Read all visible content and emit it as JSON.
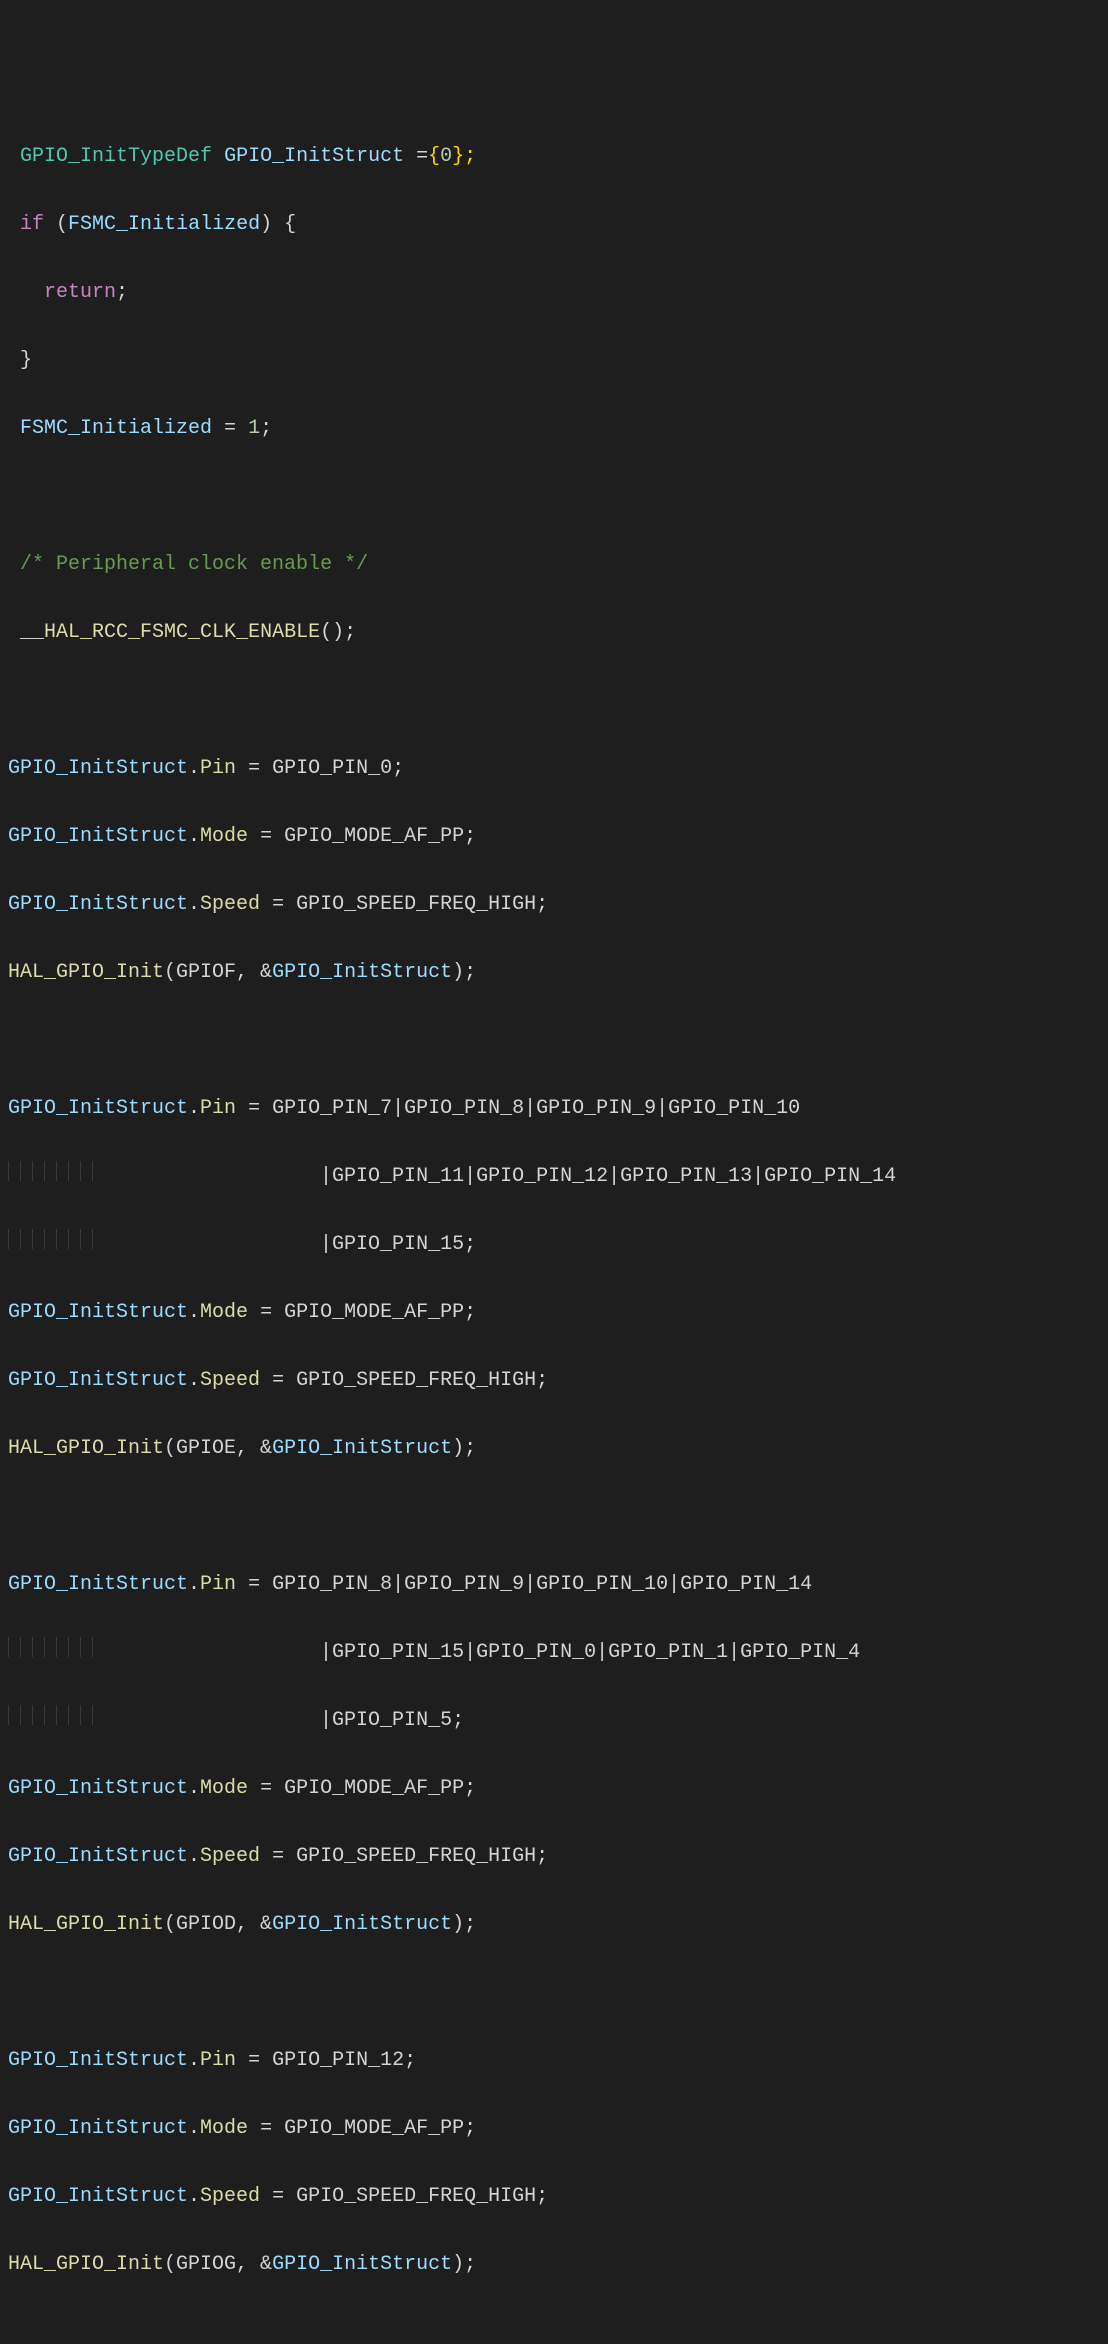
{
  "code": {
    "l1_type": "GPIO_InitTypeDef",
    "l1_var": "GPIO_InitStruct",
    "l1_eq": " =",
    "l1_brace_open": "{",
    "l1_zero": "0",
    "l1_brace_close": "};",
    "l2_if": "if",
    "l2_open": " (",
    "l2_cond": "FSMC_Initialized",
    "l2_close": ") {",
    "l3_return": "return",
    "l3_semi": ";",
    "l4_close": "}",
    "l5_var": "FSMC_Initialized",
    "l5_rest": " = ",
    "l5_one": "1",
    "l5_semi": ";",
    "l7_comment": "/* Peripheral clock enable */",
    "l8_us": "__",
    "l8_macro": "HAL_RCC_FSMC_CLK_ENABLE",
    "l8_call": "();",
    "b1_l1_lhs": "GPIO_InitStruct",
    "b1_l1_dot": ".",
    "b1_l1_mem": "Pin",
    "b1_l1_eq": " = ",
    "b1_l1_rhs": "GPIO_PIN_0;",
    "b1_l2_lhs": "GPIO_InitStruct",
    "b1_l2_mem": "Mode",
    "b1_l2_rhs": "GPIO_MODE_AF_PP;",
    "b1_l3_lhs": "GPIO_InitStruct",
    "b1_l3_mem": "Speed",
    "b1_l3_rhs": "GPIO_SPEED_FREQ_HIGH;",
    "b1_l4_fn": "HAL_GPIO_Init",
    "b1_l4_args1": "(GPIOF, &",
    "b1_l4_args2": "GPIO_InitStruct",
    "b1_l4_args3": ");",
    "b2_l1_lhs": "GPIO_InitStruct",
    "b2_l1_mem": "Pin",
    "b2_l1_rhs": "GPIO_PIN_7|GPIO_PIN_8|GPIO_PIN_9|GPIO_PIN_10",
    "b2_l2_rhs": "|GPIO_PIN_11|GPIO_PIN_12|GPIO_PIN_13|GPIO_PIN_14",
    "b2_l3_rhs": "|GPIO_PIN_15;",
    "b2_l4_lhs": "GPIO_InitStruct",
    "b2_l4_mem": "Mode",
    "b2_l4_rhs": "GPIO_MODE_AF_PP;",
    "b2_l5_lhs": "GPIO_InitStruct",
    "b2_l5_mem": "Speed",
    "b2_l5_rhs": "GPIO_SPEED_FREQ_HIGH;",
    "b2_l6_fn": "HAL_GPIO_Init",
    "b2_l6_args1": "(GPIOE, &",
    "b2_l6_args2": "GPIO_InitStruct",
    "b2_l6_args3": ");",
    "b3_l1_lhs": "GPIO_InitStruct",
    "b3_l1_mem": "Pin",
    "b3_l1_rhs": "GPIO_PIN_8|GPIO_PIN_9|GPIO_PIN_10|GPIO_PIN_14",
    "b3_l2_rhs": "|GPIO_PIN_15|GPIO_PIN_0|GPIO_PIN_1|GPIO_PIN_4",
    "b3_l3_rhs": "|GPIO_PIN_5;",
    "b3_l4_lhs": "GPIO_InitStruct",
    "b3_l4_mem": "Mode",
    "b3_l4_rhs": "GPIO_MODE_AF_PP;",
    "b3_l5_lhs": "GPIO_InitStruct",
    "b3_l5_mem": "Speed",
    "b3_l5_rhs": "GPIO_SPEED_FREQ_HIGH;",
    "b3_l6_fn": "HAL_GPIO_Init",
    "b3_l6_args1": "(GPIOD, &",
    "b3_l6_args2": "GPIO_InitStruct",
    "b3_l6_args3": ");",
    "b4_l1_lhs": "GPIO_InitStruct",
    "b4_l1_mem": "Pin",
    "b4_l1_rhs": "GPIO_PIN_12;",
    "b4_l2_lhs": "GPIO_InitStruct",
    "b4_l2_mem": "Mode",
    "b4_l2_rhs": "GPIO_MODE_AF_PP;",
    "b4_l3_lhs": "GPIO_InitStruct",
    "b4_l3_mem": "Speed",
    "b4_l3_rhs": "GPIO_SPEED_FREQ_HIGH;",
    "b4_l4_fn": "HAL_GPIO_Init",
    "b4_l4_args1": "(GPIOG, &",
    "b4_l4_args2": "GPIO_InitStruct",
    "b4_l4_args3": ");"
  }
}
